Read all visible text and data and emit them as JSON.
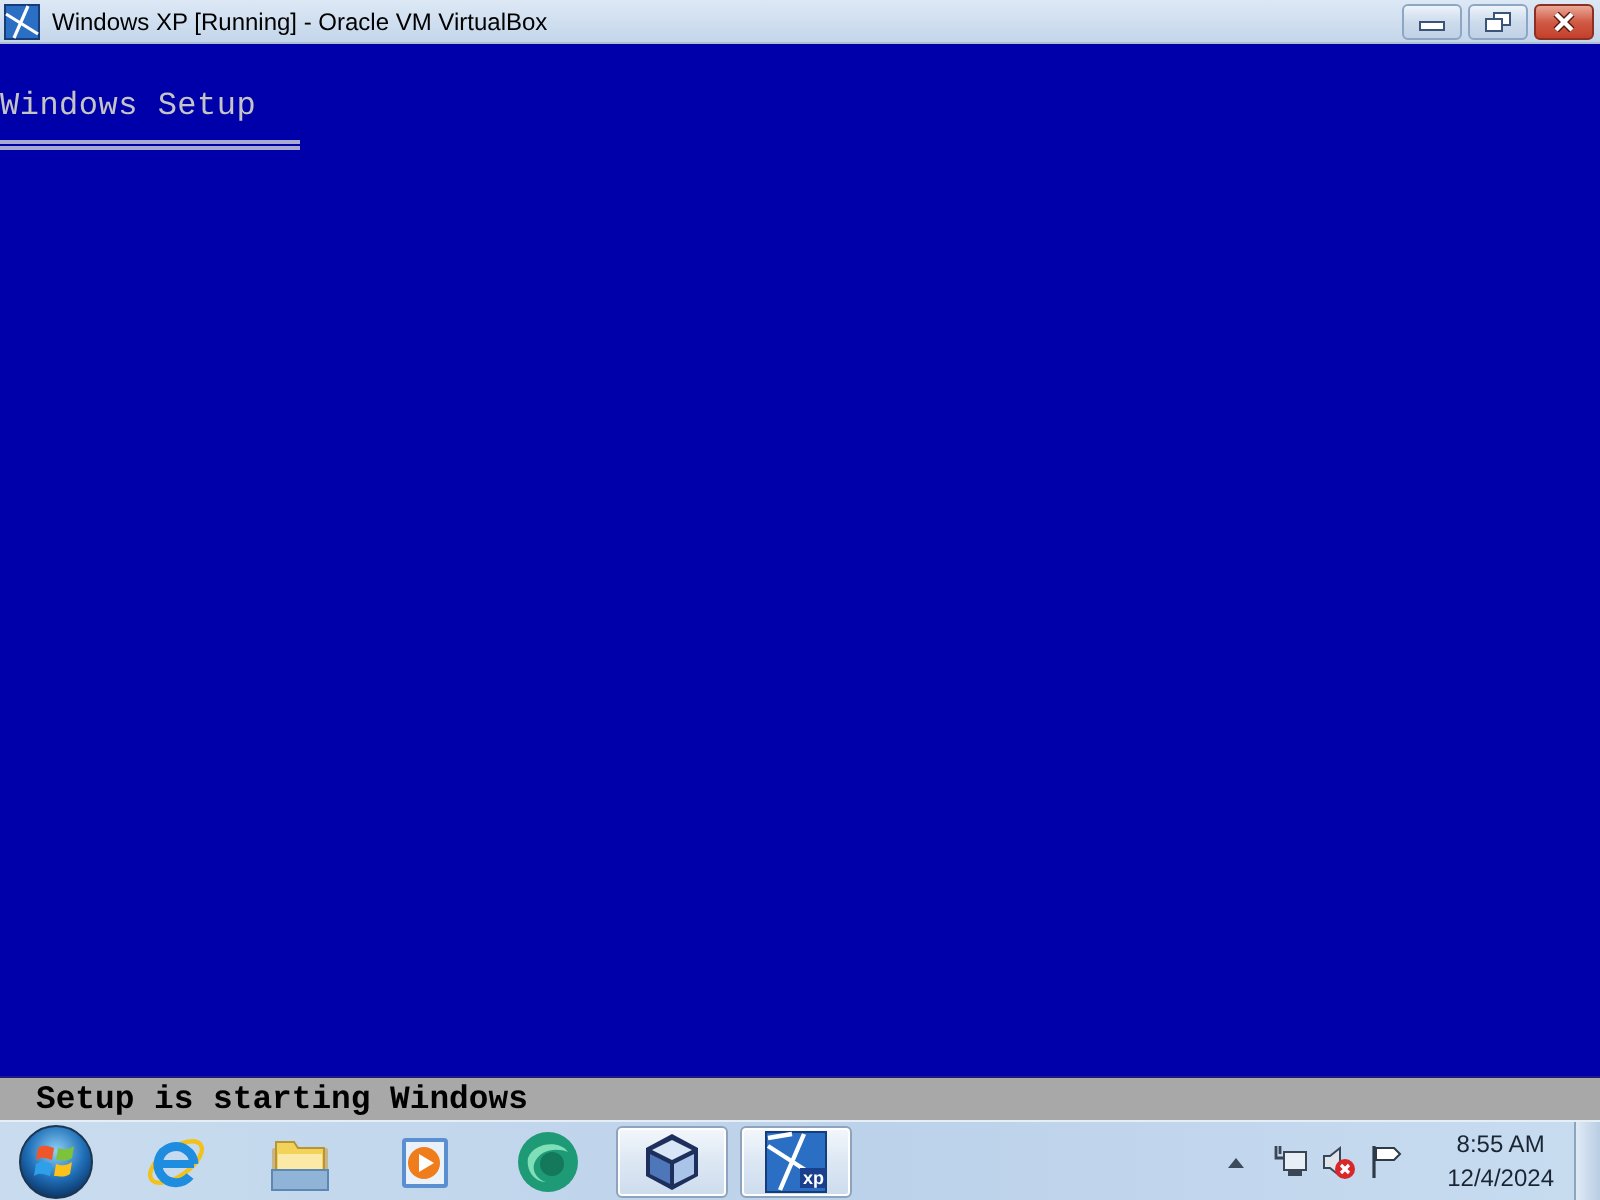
{
  "window": {
    "title": "Windows XP [Running] - Oracle VM VirtualBox"
  },
  "vm_screen": {
    "heading": "Windows Setup",
    "status": "Setup is starting Windows"
  },
  "taskbar": {
    "apps": [
      {
        "kind": "browser",
        "running": false
      },
      {
        "kind": "folder",
        "running": false
      },
      {
        "kind": "media",
        "running": false
      },
      {
        "kind": "sphere",
        "running": false
      },
      {
        "kind": "cube",
        "running": true
      },
      {
        "kind": "vm",
        "running": true,
        "label": "xp"
      }
    ]
  },
  "tray": {
    "volume_muted": true,
    "time": "8:55 AM",
    "date": "12/4/2024"
  }
}
